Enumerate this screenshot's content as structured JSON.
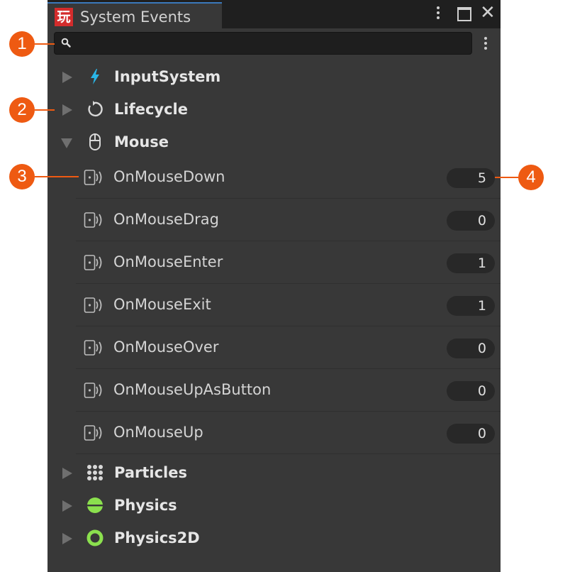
{
  "window": {
    "title": "System Events",
    "tab_icon_glyph": "玩"
  },
  "search": {
    "value": "",
    "placeholder": ""
  },
  "categories": [
    {
      "label": "InputSystem",
      "icon": "lightning-icon",
      "expanded": false
    },
    {
      "label": "Lifecycle",
      "icon": "refresh-cycle-icon",
      "expanded": false
    },
    {
      "label": "Mouse",
      "icon": "mouse-icon",
      "expanded": true
    },
    {
      "label": "Particles",
      "icon": "particles-grid-icon",
      "expanded": false
    },
    {
      "label": "Physics",
      "icon": "physics-sphere-icon",
      "expanded": false
    },
    {
      "label": "Physics2D",
      "icon": "physics2d-ring-icon",
      "expanded": false
    }
  ],
  "mouse_events": [
    {
      "label": "OnMouseDown",
      "count": "5"
    },
    {
      "label": "OnMouseDrag",
      "count": "0"
    },
    {
      "label": "OnMouseEnter",
      "count": "1"
    },
    {
      "label": "OnMouseExit",
      "count": "1"
    },
    {
      "label": "OnMouseOver",
      "count": "0"
    },
    {
      "label": "OnMouseUpAsButton",
      "count": "0"
    },
    {
      "label": "OnMouseUp",
      "count": "0"
    }
  ],
  "callouts": [
    "1",
    "2",
    "3",
    "4"
  ],
  "colors": {
    "panel": "#383838",
    "titlebar": "#1f1f1f",
    "accent_tab": "#3a79bb",
    "callout": "#ee5a12",
    "input_icon": "#29b6e8",
    "physics": "#8be04e"
  }
}
